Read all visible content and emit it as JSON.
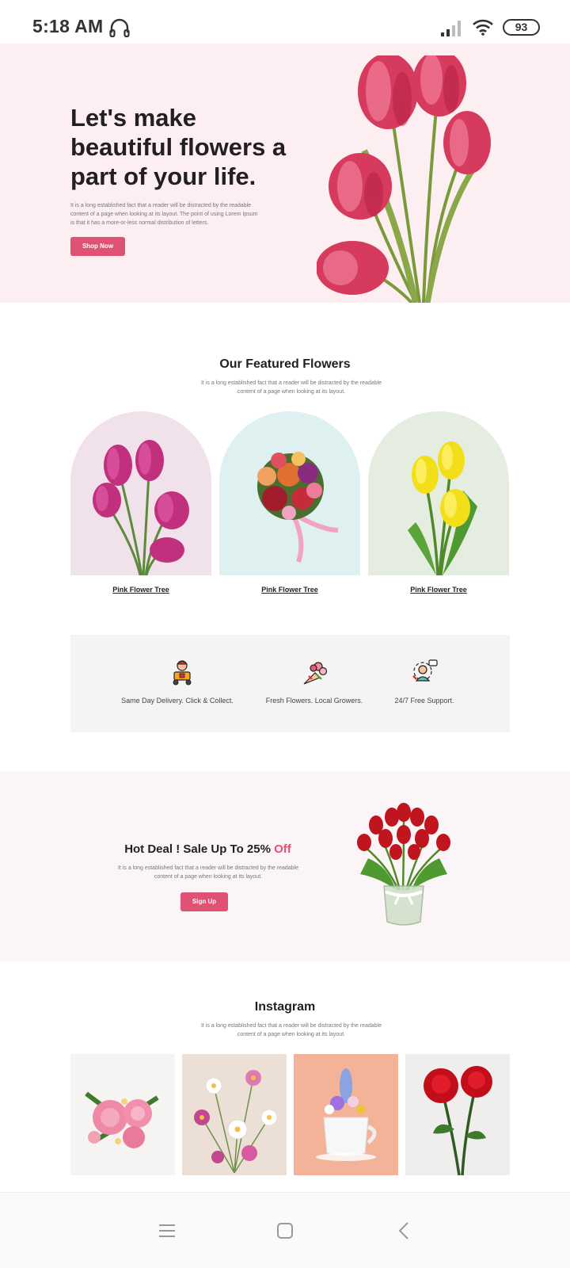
{
  "status_bar": {
    "time": "5:18 AM",
    "battery": "93",
    "icons": [
      "headphone-icon",
      "signal-icon",
      "wifi-icon",
      "battery-icon"
    ]
  },
  "hero": {
    "title": "Let's make beautiful flowers a part of your life.",
    "text": "It is a long established fact that a reader will be distracted by the readable content of a page when looking at its layout. The point of using Lorem Ipsum is that it has a more-or-less normal distribution of letters.",
    "button_label": "Shop Now"
  },
  "featured": {
    "title": "Our Featured Flowers",
    "subtitle": "It is a long established fact that a reader will be distracted by the readable content of a page when looking at its layout.",
    "items": [
      {
        "label": "Pink Flower Tree",
        "bg": "#f1e1ea"
      },
      {
        "label": "Pink Flower Tree",
        "bg": "#dff0f0"
      },
      {
        "label": "Pink Flower Tree",
        "bg": "#e5ede0"
      }
    ]
  },
  "features": [
    {
      "label": "Same Day Delivery. Click & Collect.",
      "icon": "delivery-icon"
    },
    {
      "label": "Fresh Flowers. Local Growers.",
      "icon": "bouquet-icon"
    },
    {
      "label": "24/7 Free Support.",
      "icon": "support-icon"
    }
  ],
  "deal": {
    "title_main": "Hot Deal ! Sale Up To 25% ",
    "title_accent": "Off",
    "subtitle": "It is a long established fact that a reader will be distracted by the readable content of a page when looking at its layout.",
    "button_label": "Sign Up"
  },
  "instagram": {
    "title": "Instagram",
    "subtitle": "It is a long established fact that a reader will be distracted by the readable content of a page when looking at its layout."
  },
  "nav_bar": {
    "buttons": [
      "menu-icon",
      "home-icon",
      "back-icon"
    ]
  },
  "colors": {
    "accent": "#e05273",
    "hero_bg": "#fdeff1",
    "deal_bg": "#fcf5f7",
    "features_bg": "#f4f4f4"
  }
}
